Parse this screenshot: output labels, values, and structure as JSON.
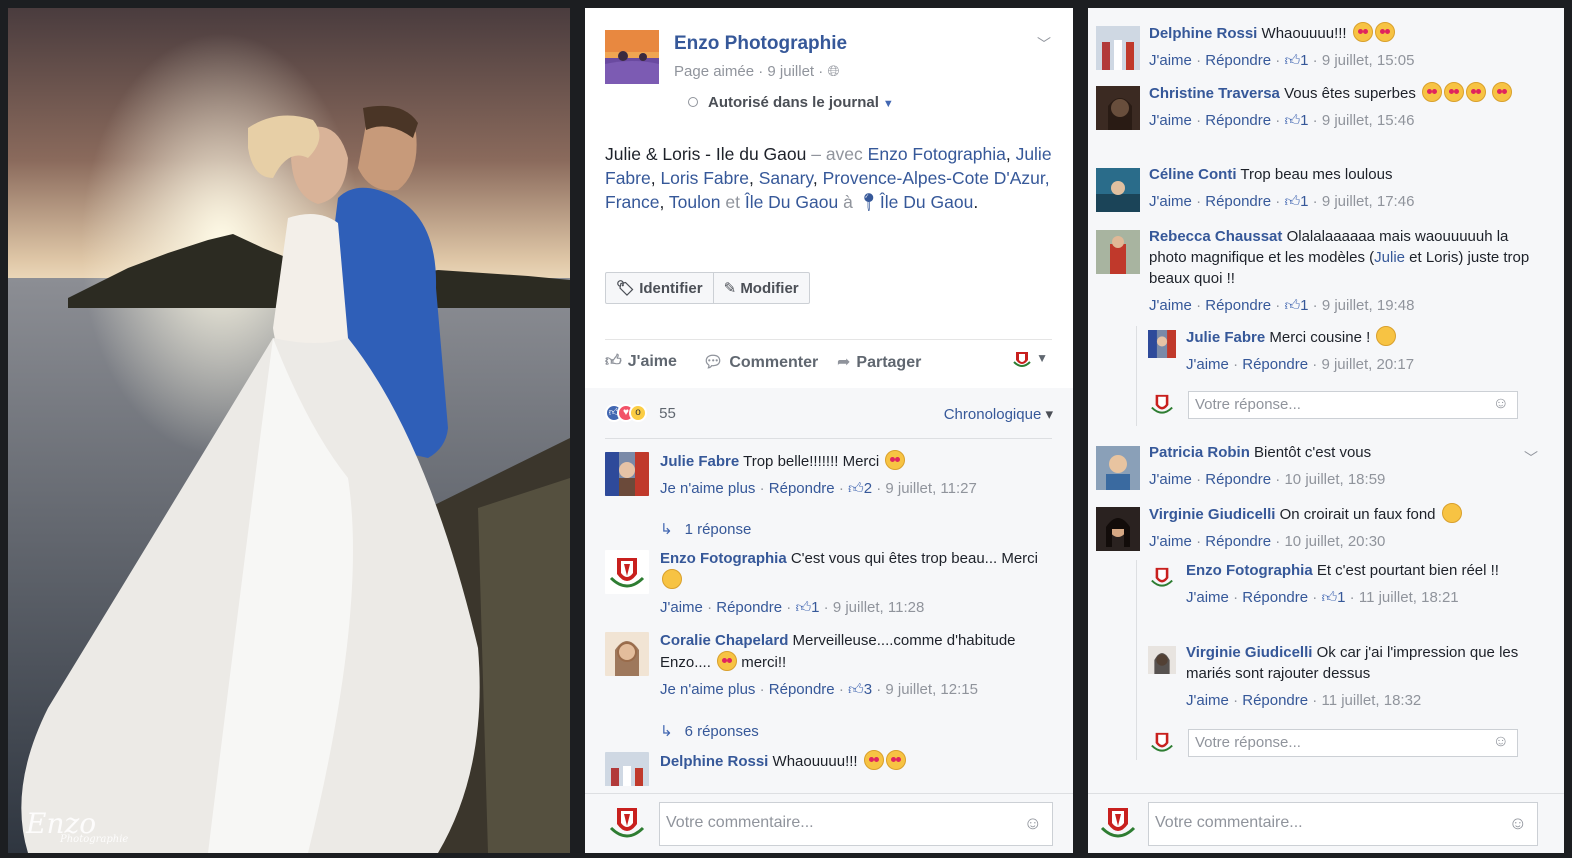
{
  "page": {
    "name": "Enzo Photographie",
    "liked": "Page aimée",
    "date": "9 juillet",
    "authorized": "Autorisé dans le journal"
  },
  "post": {
    "title": "Julie & Loris - Ile du Gaou",
    "with_prefix": "– avec",
    "tags": [
      "Enzo Fotographia",
      "Julie Fabre",
      "Loris Fabre",
      "Sanary",
      "Provence-Alpes-Cote D'Azur, France",
      "Toulon"
    ],
    "and_word": "et",
    "last_tag": "Île Du Gaou",
    "at_word": "à",
    "place": "Île Du Gaou"
  },
  "buttons": {
    "tag": "Identifier",
    "edit": "Modifier"
  },
  "actions": {
    "like": "J'aime",
    "comment": "Commenter",
    "share": "Partager"
  },
  "reactions": {
    "count": "55",
    "order_label": "Chronologique"
  },
  "labels": {
    "like": "J'aime",
    "unlike": "Je n'aime plus",
    "reply": "Répondre",
    "comment_placeholder": "Votre commentaire...",
    "reply_placeholder": "Votre réponse..."
  },
  "watermark": {
    "title": "Enzo",
    "subtitle": "Photographie"
  },
  "mid_comments": [
    {
      "author": "Julie Fabre",
      "text": "Trop belle!!!!!!! Merci",
      "like_label": "Je n'aime plus",
      "likes": "2",
      "time": "9 juillet, 11:27",
      "replies": "1 réponse"
    },
    {
      "author": "Enzo Fotographia",
      "text": "C'est vous qui êtes trop beau... Merci",
      "like_label": "J'aime",
      "likes": "1",
      "time": "9 juillet, 11:28"
    },
    {
      "author": "Coralie Chapelard",
      "text": "Merveilleuse....comme d'habitude Enzo....",
      "text_after": "merci!!",
      "like_label": "Je n'aime plus",
      "likes": "3",
      "time": "9 juillet, 12:15",
      "replies": "6 réponses"
    },
    {
      "author": "Delphine Rossi",
      "text": "Whaouuuu!!!"
    }
  ],
  "right_comments": [
    {
      "author": "Delphine Rossi",
      "text": "Whaouuuu!!!",
      "likes": "1",
      "time": "9 juillet, 15:05"
    },
    {
      "author": "Christine Traversa",
      "text": "Vous êtes superbes",
      "likes": "1",
      "time": "9 juillet, 15:46"
    },
    {
      "author": "Céline Conti",
      "text": "Trop beau mes loulous",
      "likes": "1",
      "time": "9 juillet, 17:46"
    },
    {
      "author": "Rebecca Chaussat",
      "text_a": "Olalalaaaaaa mais waouuuuuh la photo magnifique et les modèles (",
      "text_link": "Julie",
      "text_b": " et Loris) juste trop beaux quoi !!",
      "likes": "1",
      "time": "9 juillet, 19:48"
    },
    {
      "author": "Julie Fabre",
      "text": "Merci cousine !",
      "time": "9 juillet, 20:17"
    },
    {
      "author": "Patricia Robin",
      "text": "Bientôt c'est vous",
      "time": "10 juillet, 18:59"
    },
    {
      "author": "Virginie Giudicelli",
      "text": "On croirait un faux fond",
      "time": "10 juillet, 20:30"
    },
    {
      "author": "Enzo Fotographia",
      "text": "Et c'est pourtant bien réel !!",
      "likes": "1",
      "time": "11 juillet, 18:21"
    },
    {
      "author": "Virginie Giudicelli",
      "text": "Ok car j'ai l'impression que les mariés sont rajouter dessus",
      "time": "11 juillet, 18:32"
    }
  ]
}
